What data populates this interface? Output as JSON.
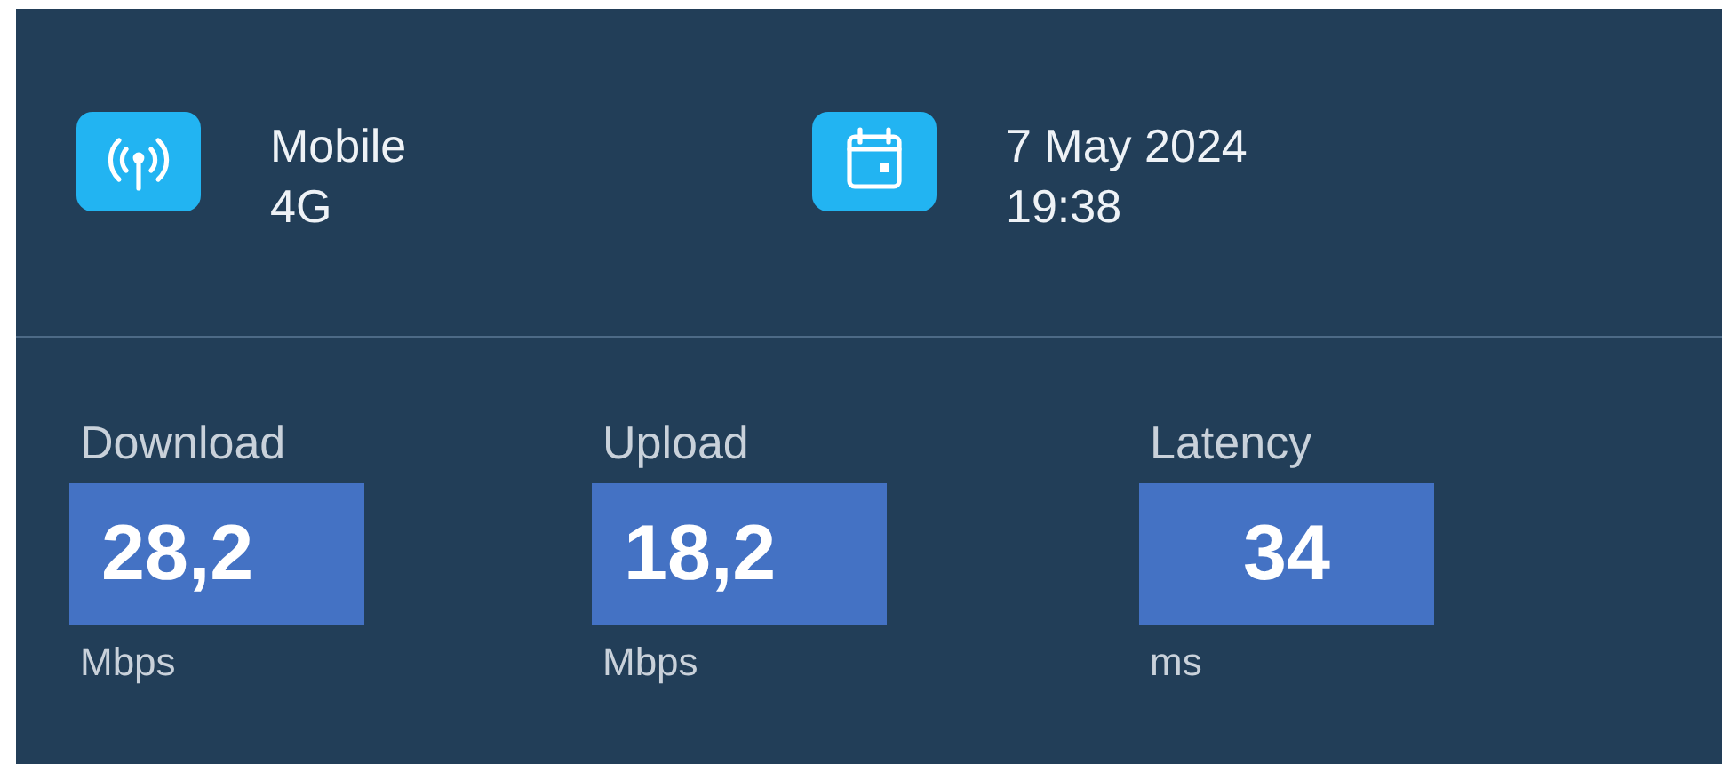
{
  "header": [
    {
      "kind": "antenna",
      "line_1": "Mobile",
      "line_2": "4G"
    },
    {
      "kind": "calendar",
      "line_1": "7 May 2024",
      "line_2": "19:38"
    }
  ],
  "metrics": [
    {
      "label": "Download",
      "value": "28,2",
      "unit": "Mbps"
    },
    {
      "label": "Upload",
      "value": "18,2",
      "unit": "Mbps"
    },
    {
      "label": "Latency",
      "value": "34",
      "unit": "ms"
    }
  ]
}
